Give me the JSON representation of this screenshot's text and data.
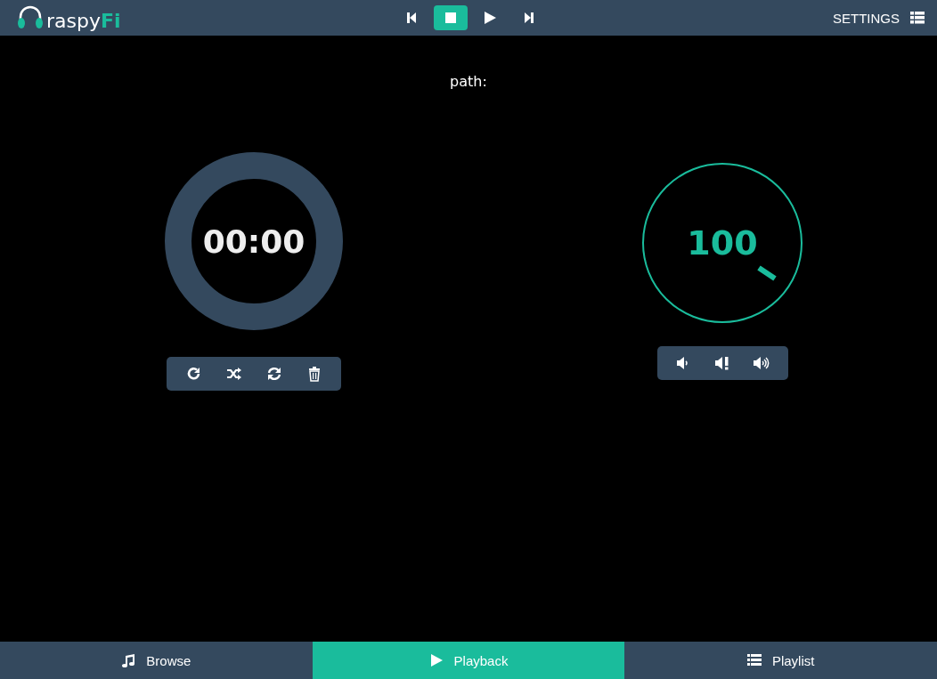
{
  "header": {
    "logo": {
      "text": "raspy",
      "accent": "Fi"
    },
    "transport": [
      {
        "kind": "previous",
        "selected": false
      },
      {
        "kind": "stop",
        "selected": true
      },
      {
        "kind": "play",
        "selected": false
      },
      {
        "kind": "next",
        "selected": false
      }
    ],
    "settings": {
      "label": "SETTINGS"
    }
  },
  "path": {
    "label": "path:"
  },
  "time": {
    "text": "00:00"
  },
  "playback_modes": [
    {
      "kind": "repeat"
    },
    {
      "kind": "shuffle"
    },
    {
      "kind": "refresh"
    },
    {
      "kind": "delete"
    }
  ],
  "volume": {
    "text": "100"
  },
  "volume_buttons": [
    {
      "kind": "down"
    },
    {
      "kind": "mute"
    },
    {
      "kind": "up"
    }
  ],
  "tabs": [
    {
      "kind": "browse",
      "label": "Browse",
      "selected": false
    },
    {
      "kind": "playback",
      "label": "Playback",
      "selected": true
    },
    {
      "kind": "playlist",
      "label": "Playlist",
      "selected": false
    }
  ]
}
